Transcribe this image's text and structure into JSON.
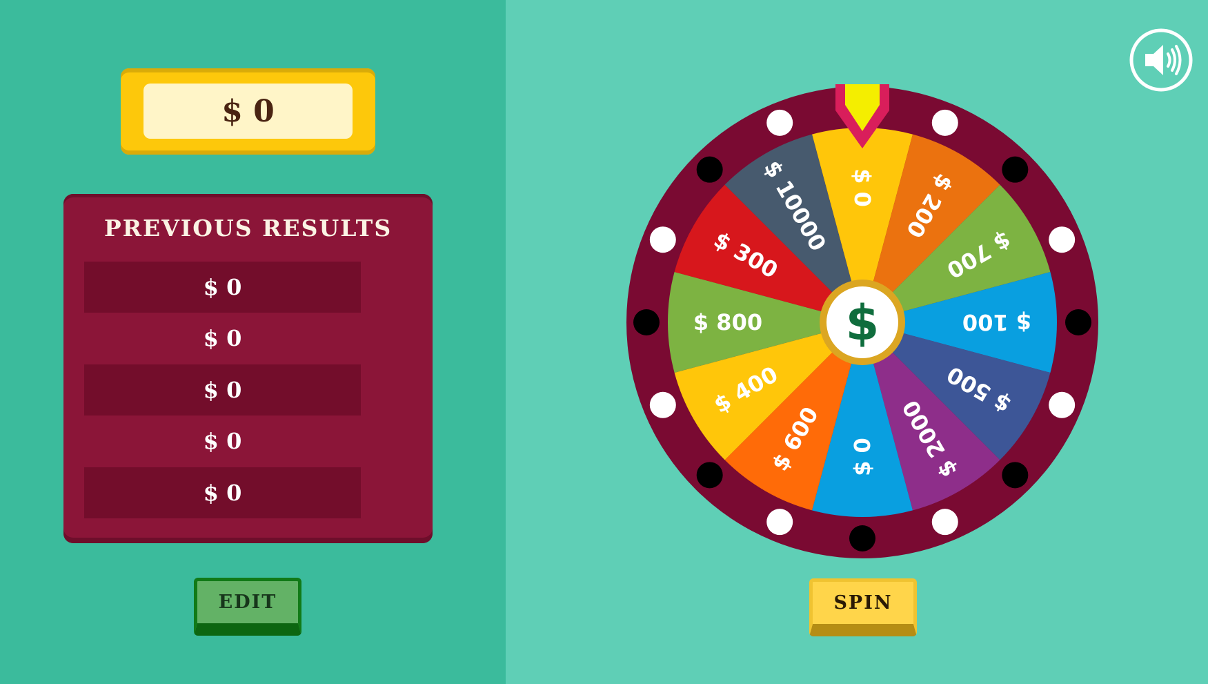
{
  "score": {
    "value": "$ 0"
  },
  "previous_results": {
    "title": "PREVIOUS RESULTS",
    "items": [
      "$ 0",
      "$ 0",
      "$ 0",
      "$ 0",
      "$ 0"
    ]
  },
  "buttons": {
    "edit_label": "EDIT",
    "spin_label": "SPIN"
  },
  "sound": {
    "icon": "speaker-icon"
  },
  "wheel": {
    "center_icon": "dollar-icon",
    "center_symbol": "$",
    "pointer_icon": "pointer-icon",
    "segments": [
      {
        "label": "$ 0",
        "color": "#ffc60a"
      },
      {
        "label": "$ 200",
        "color": "#eb720f"
      },
      {
        "label": "$ 700",
        "color": "#7db342"
      },
      {
        "label": "$ 100",
        "color": "#099fe0"
      },
      {
        "label": "$ 500",
        "color": "#3d5697"
      },
      {
        "label": "$ 2000",
        "color": "#8e2e8a"
      },
      {
        "label": "$ 0",
        "color": "#099fe0"
      },
      {
        "label": "$ 600",
        "color": "#ff6b08"
      },
      {
        "label": "$ 400",
        "color": "#ffc60a"
      },
      {
        "label": "$ 800",
        "color": "#7db342"
      },
      {
        "label": "$ 300",
        "color": "#d7171c"
      },
      {
        "label": "$ 10000",
        "color": "#475a6e"
      }
    ]
  },
  "colors": {
    "left_bg": "#3bbb9c",
    "right_bg": "#5fcfb6",
    "rim": "#7a0a32",
    "pointer_border": "#d91e5b",
    "pointer_fill": "#f4ee00"
  }
}
